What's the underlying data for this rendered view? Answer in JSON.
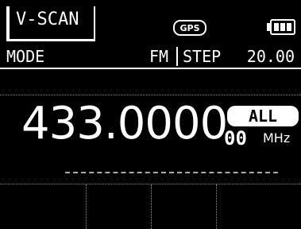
{
  "status": {
    "scan_mode": "V-SCAN",
    "gps_label": "GPS",
    "battery_icon": "battery-full-icon"
  },
  "mode_row": {
    "mode_label": "MODE",
    "mode_value": "FM",
    "step_label": "STEP",
    "step_value": "20.00"
  },
  "frequency": {
    "main": "433.0000",
    "sub_digits": "00",
    "unit": "MHz",
    "memory_badge": "ALL"
  },
  "softkeys": [
    {
      "label": ""
    },
    {
      "label": ""
    },
    {
      "label": ""
    },
    {
      "label": ""
    }
  ],
  "colors": {
    "background": "#000000",
    "foreground": "#ffffff"
  }
}
